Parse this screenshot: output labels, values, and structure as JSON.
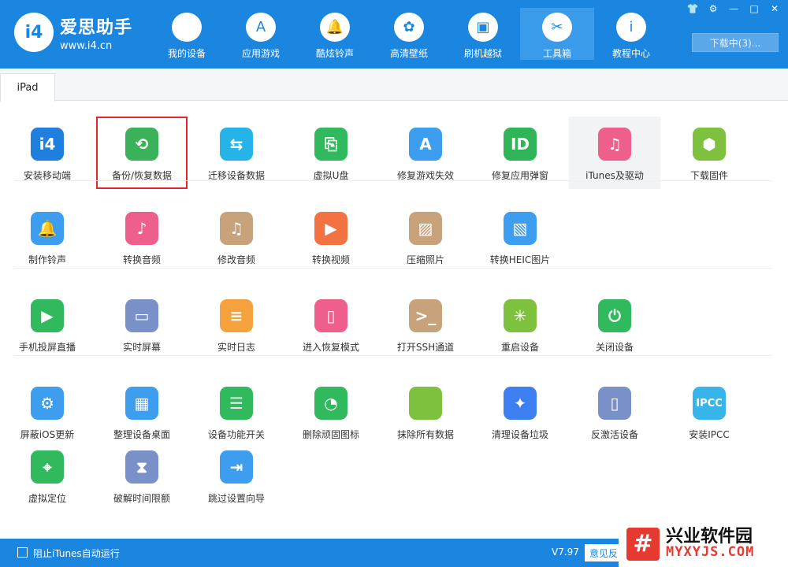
{
  "app": {
    "logo_mark": "i4",
    "title": "爱思助手",
    "url": "www.i4.cn"
  },
  "nav": [
    {
      "label": "我的设备",
      "icon": "apple-icon",
      "glyph": "",
      "active": false
    },
    {
      "label": "应用游戏",
      "icon": "app-store-icon",
      "glyph": "A",
      "active": false
    },
    {
      "label": "酷炫铃声",
      "icon": "bell-icon",
      "glyph": "🔔",
      "active": false
    },
    {
      "label": "高清壁纸",
      "icon": "flower-icon",
      "glyph": "✿",
      "active": false
    },
    {
      "label": "刷机越狱",
      "icon": "box-icon",
      "glyph": "▣",
      "active": false
    },
    {
      "label": "工具箱",
      "icon": "tools-icon",
      "glyph": "✂",
      "active": true
    },
    {
      "label": "教程中心",
      "icon": "info-icon",
      "glyph": "i",
      "active": false
    }
  ],
  "window_controls": [
    "👕",
    "⚙",
    "—",
    "□",
    "✕"
  ],
  "download_label": "下载中(3)...",
  "tabs": [
    {
      "label": "iPad"
    }
  ],
  "rows": [
    [
      {
        "label": "安装移动端",
        "icon": "i4-app-icon",
        "glyph": "i4",
        "color": "#1f7fdf"
      },
      {
        "label": "备份/恢复数据",
        "icon": "backup-restore-icon",
        "glyph": "⟲",
        "color": "#3bb25a",
        "selected": true
      },
      {
        "label": "迁移设备数据",
        "icon": "migrate-data-icon",
        "glyph": "⇆",
        "color": "#25b3e8"
      },
      {
        "label": "虚拟U盘",
        "icon": "usb-drive-icon",
        "glyph": "⎘",
        "color": "#31b95d"
      },
      {
        "label": "修复游戏失效",
        "icon": "repair-game-icon",
        "glyph": "A",
        "color": "#3d9ef0"
      },
      {
        "label": "修复应用弹窗",
        "icon": "apple-id-icon",
        "glyph": "ID",
        "color": "#2fb457"
      },
      {
        "label": "iTunes及驱动",
        "icon": "itunes-icon",
        "glyph": "♫",
        "color": "#ef5f8b",
        "hover": true
      },
      {
        "label": "下载固件",
        "icon": "firmware-cube-icon",
        "glyph": "⬢",
        "color": "#7ec13f"
      }
    ],
    [
      {
        "label": "制作铃声",
        "icon": "ringtone-bell-icon",
        "glyph": "🔔",
        "color": "#3d9ef0"
      },
      {
        "label": "转换音频",
        "icon": "convert-audio-icon",
        "glyph": "♪",
        "color": "#ef5f8b"
      },
      {
        "label": "修改音频",
        "icon": "edit-audio-icon",
        "glyph": "♫",
        "color": "#c8a27a"
      },
      {
        "label": "转换视频",
        "icon": "convert-video-icon",
        "glyph": "▶",
        "color": "#f27341"
      },
      {
        "label": "压缩照片",
        "icon": "compress-photo-icon",
        "glyph": "▨",
        "color": "#c8a27a"
      },
      {
        "label": "转换HEIC图片",
        "icon": "heic-convert-icon",
        "glyph": "▧",
        "color": "#3d9ef0"
      }
    ],
    [
      {
        "label": "手机投屏直播",
        "icon": "screen-cast-icon",
        "glyph": "▶",
        "color": "#31b95d"
      },
      {
        "label": "实时屏幕",
        "icon": "live-screen-icon",
        "glyph": "▭",
        "color": "#7a90c9"
      },
      {
        "label": "实时日志",
        "icon": "live-log-icon",
        "glyph": "≡",
        "color": "#f5a23c"
      },
      {
        "label": "进入恢复模式",
        "icon": "recovery-mode-icon",
        "glyph": "▯",
        "color": "#ef5f8b"
      },
      {
        "label": "打开SSH通道",
        "icon": "ssh-terminal-icon",
        "glyph": ">_",
        "color": "#c8a27a"
      },
      {
        "label": "重启设备",
        "icon": "reboot-icon",
        "glyph": "✳",
        "color": "#7ec13f"
      },
      {
        "label": "关闭设备",
        "icon": "power-icon",
        "glyph": "⏻",
        "color": "#31b95d"
      }
    ],
    [
      {
        "label": "屏蔽iOS更新",
        "icon": "block-update-icon",
        "glyph": "⚙",
        "color": "#3d9ef0"
      },
      {
        "label": "整理设备桌面",
        "icon": "organize-desktop-icon",
        "glyph": "▦",
        "color": "#3d9ef0"
      },
      {
        "label": "设备功能开关",
        "icon": "feature-toggle-icon",
        "glyph": "☰",
        "color": "#31b95d"
      },
      {
        "label": "删除顽固图标",
        "icon": "delete-icon-icon",
        "glyph": "◔",
        "color": "#31b95d"
      },
      {
        "label": "抹除所有数据",
        "icon": "erase-data-icon",
        "glyph": "",
        "color": "#7ec13f"
      },
      {
        "label": "清理设备垃圾",
        "icon": "clean-junk-icon",
        "glyph": "✦",
        "color": "#3d7ff0"
      },
      {
        "label": "反激活设备",
        "icon": "deactivate-icon",
        "glyph": "▯",
        "color": "#7a90c9"
      },
      {
        "label": "安装IPCC",
        "icon": "ipcc-icon",
        "glyph": "IPCC",
        "color": "#37b5ea"
      }
    ],
    [
      {
        "label": "虚拟定位",
        "icon": "location-pin-icon",
        "glyph": "⌖",
        "color": "#31b95d"
      },
      {
        "label": "破解时间限额",
        "icon": "hourglass-icon",
        "glyph": "⧗",
        "color": "#7a90c9"
      },
      {
        "label": "跳过设置向导",
        "icon": "skip-setup-icon",
        "glyph": "⇥",
        "color": "#3d9ef0"
      }
    ]
  ],
  "footer": {
    "itunes_autorun_label": "阻止iTunes自动运行",
    "version": "V7.97",
    "feedback_label": "意见反"
  },
  "watermark": {
    "mark": "#",
    "cn": "兴业软件园",
    "en": "MYXYJS.COM"
  }
}
